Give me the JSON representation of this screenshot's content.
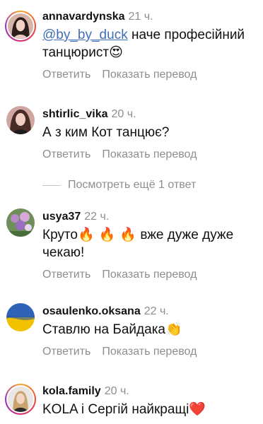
{
  "comments": [
    {
      "username": "annavardynska",
      "time": "21 ч.",
      "mention": "@by_by_duck",
      "text": " наче професійний танцюрист",
      "emoji": "😍",
      "reply": "Ответить",
      "translate": "Показать перевод"
    },
    {
      "username": "shtirlic_vika",
      "time": "20 ч.",
      "text": "А з ким Кот танцює?",
      "reply": "Ответить",
      "translate": "Показать перевод"
    },
    {
      "username": "usya37",
      "time": "22 ч.",
      "text_start": "Круто",
      "emoji": "🔥 🔥 🔥",
      "text_end": " вже дуже дуже чекаю!",
      "reply": "Ответить",
      "translate": "Показать перевод"
    },
    {
      "username": "osaulenko.oksana",
      "time": "22 ч.",
      "text": "Ставлю на Байдака",
      "emoji": "👏",
      "reply": "Ответить",
      "translate": "Показать перевод"
    },
    {
      "username": "kola.family",
      "time": "20 ч.",
      "text": "KOLA і Сергій найкращі",
      "emoji": "❤️"
    }
  ],
  "more_replies": "Посмотреть ещё 1 ответ",
  "colors": {
    "mention": "#3f6fb5",
    "secondary": "#8e8e8e",
    "primary_text": "#111111"
  }
}
